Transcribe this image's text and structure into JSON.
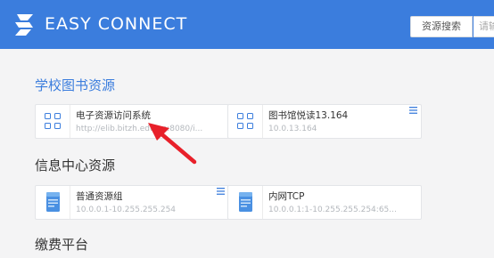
{
  "header": {
    "brand": "EASY CONNECT",
    "search_button": "资源搜索",
    "search_placeholder": "请输"
  },
  "sections": [
    {
      "title": "学校图书资源",
      "cards": [
        {
          "name": "电子资源访问系统",
          "address": "http://elib.bitzh.edu.cn:8080/i...",
          "icon": "grid-icon",
          "has_menu": false
        },
        {
          "name": "图书馆悦读13.164",
          "address": "10.0.13.164",
          "icon": "grid-icon",
          "has_menu": true
        }
      ]
    },
    {
      "title": "信息中心资源",
      "cards": [
        {
          "name": "普通资源组",
          "address": "10.0.0.1-10.255.255.254",
          "icon": "book-icon",
          "has_menu": true
        },
        {
          "name": "内网TCP",
          "address": "10.0.0.1:1-10.255.255.254:65...",
          "icon": "book-icon",
          "has_menu": false
        }
      ]
    },
    {
      "title": "缴费平台",
      "cards": []
    }
  ],
  "colors": {
    "header": "#3b7ddd",
    "accent": "#3b7ddd",
    "annotation_arrow": "#e8202a",
    "background": "#f4f4f5"
  }
}
